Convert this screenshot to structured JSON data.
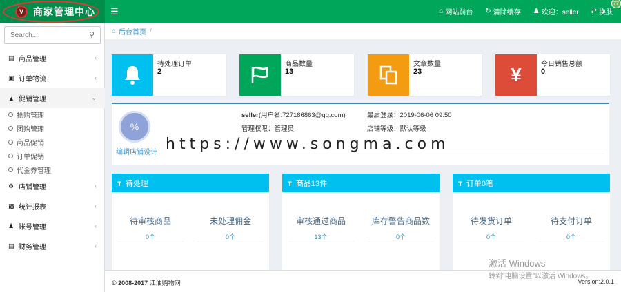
{
  "header": {
    "logo_letter": "V",
    "brand_title": "商家管理中心",
    "menu_icon": "menu-icon",
    "actions": [
      {
        "icon": "home-icon",
        "label": "网站前台"
      },
      {
        "icon": "refresh-icon",
        "label": "清除缓存"
      },
      {
        "icon": "user-icon",
        "label": "欢迎：seller"
      },
      {
        "icon": "switch-icon",
        "label": "换肤"
      }
    ],
    "badge": "77"
  },
  "sidebar": {
    "search_placeholder": "Search...",
    "items": [
      {
        "icon": "list-icon",
        "label": "商品管理"
      },
      {
        "icon": "truck-icon",
        "label": "订单物流"
      },
      {
        "icon": "bell-icon",
        "label": "促销管理",
        "open": true
      },
      {
        "icon": "gear-icon",
        "label": "店铺管理"
      },
      {
        "icon": "bar-chart-icon",
        "label": "统计报表"
      },
      {
        "icon": "user-icon",
        "label": "账号管理"
      },
      {
        "icon": "wallet-icon",
        "label": "财务管理"
      }
    ],
    "sub_items": [
      "抢购管理",
      "团购管理",
      "商品促销",
      "订单促销",
      "代金券管理"
    ]
  },
  "breadcrumb": {
    "home": "后台首页",
    "separator": "/"
  },
  "stats": [
    {
      "label": "待处理订单",
      "value": "2",
      "color": "#00c0ef",
      "icon": "bell-icon"
    },
    {
      "label": "商品数量",
      "value": "13",
      "color": "#00a65a",
      "icon": "flag-icon"
    },
    {
      "label": "文章数量",
      "value": "23",
      "color": "#f39c12",
      "icon": "copy-icon"
    },
    {
      "label": "今日销售总额",
      "value": "0",
      "color": "#dd4b39",
      "icon": "yen-icon"
    }
  ],
  "profile": {
    "avatar_icon": "percent-icon",
    "edit_label": "编辑店铺设计",
    "username": "seller",
    "account": "(用户名:727186863@qq.com)",
    "last_login": "最后登录：2019-06-06 09:50",
    "permission": "管理权限：管理员",
    "store_level": "店铺等级：默认等级"
  },
  "watermark": "https://www.songma.com",
  "panels": [
    {
      "title": "待处理",
      "cells": [
        {
          "label": "待审核商品",
          "value": "0个"
        },
        {
          "label": "未处理佣金",
          "value": "0个"
        }
      ]
    },
    {
      "title": "商品13件",
      "cells": [
        {
          "label": "审核通过商品",
          "value": "13个"
        },
        {
          "label": "库存警告商品数",
          "value": "0个"
        }
      ]
    },
    {
      "title": "订单0笔",
      "cells": [
        {
          "label": "待发货订单",
          "value": "0个"
        },
        {
          "label": "待支付订单",
          "value": "0个"
        }
      ]
    }
  ],
  "footer": {
    "copyright": "© 2008-2017",
    "site": "江油购物网",
    "version": "Version:2.0.1"
  },
  "activation": {
    "title": "激活 Windows",
    "hint": "转到\"电脑设置\"以激活 Windows。"
  }
}
